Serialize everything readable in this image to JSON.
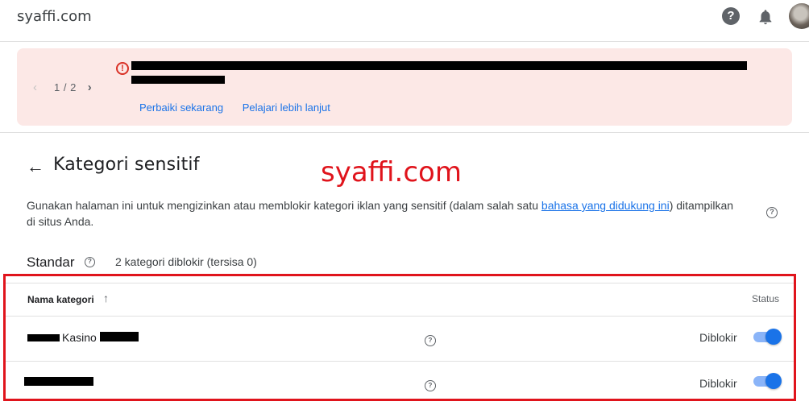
{
  "header": {
    "site_title": "syaffi.com",
    "help_glyph": "?"
  },
  "alert": {
    "pager_prev": "‹",
    "pager_count": "1 / 2",
    "pager_next": "›",
    "error_glyph": "!",
    "actions": [
      "Perbaiki sekarang",
      "Pelajari lebih lanjut"
    ]
  },
  "page": {
    "back_glyph": "←",
    "title": "Kategori sensitif",
    "watermark": "syaffi.com",
    "description_before": "Gunakan halaman ini untuk mengizinkan atau memblokir kategori iklan yang sensitif (dalam salah satu ",
    "description_link": "bahasa yang didukung ini",
    "description_after": ") ditampilkan di situs Anda.",
    "help_glyph": "?"
  },
  "section": {
    "title": "Standar",
    "summary": "2 kategori diblokir (tersisa 0)"
  },
  "table": {
    "columns": {
      "name": "Nama kategori",
      "sort_glyph": "↑",
      "status": "Status"
    },
    "rows": [
      {
        "label": "Kasino",
        "status": "Diblokir",
        "enabled": true
      },
      {
        "label": "",
        "status": "Diblokir",
        "enabled": true
      }
    ]
  },
  "colors": {
    "accent": "#1a73e8",
    "alert_bg": "#fce8e6",
    "highlight": "#e0141c"
  },
  "icons": [
    "help-icon",
    "notifications-bell-icon",
    "error-icon",
    "back-arrow-icon",
    "sort-arrow-icon",
    "toggle-switch"
  ]
}
